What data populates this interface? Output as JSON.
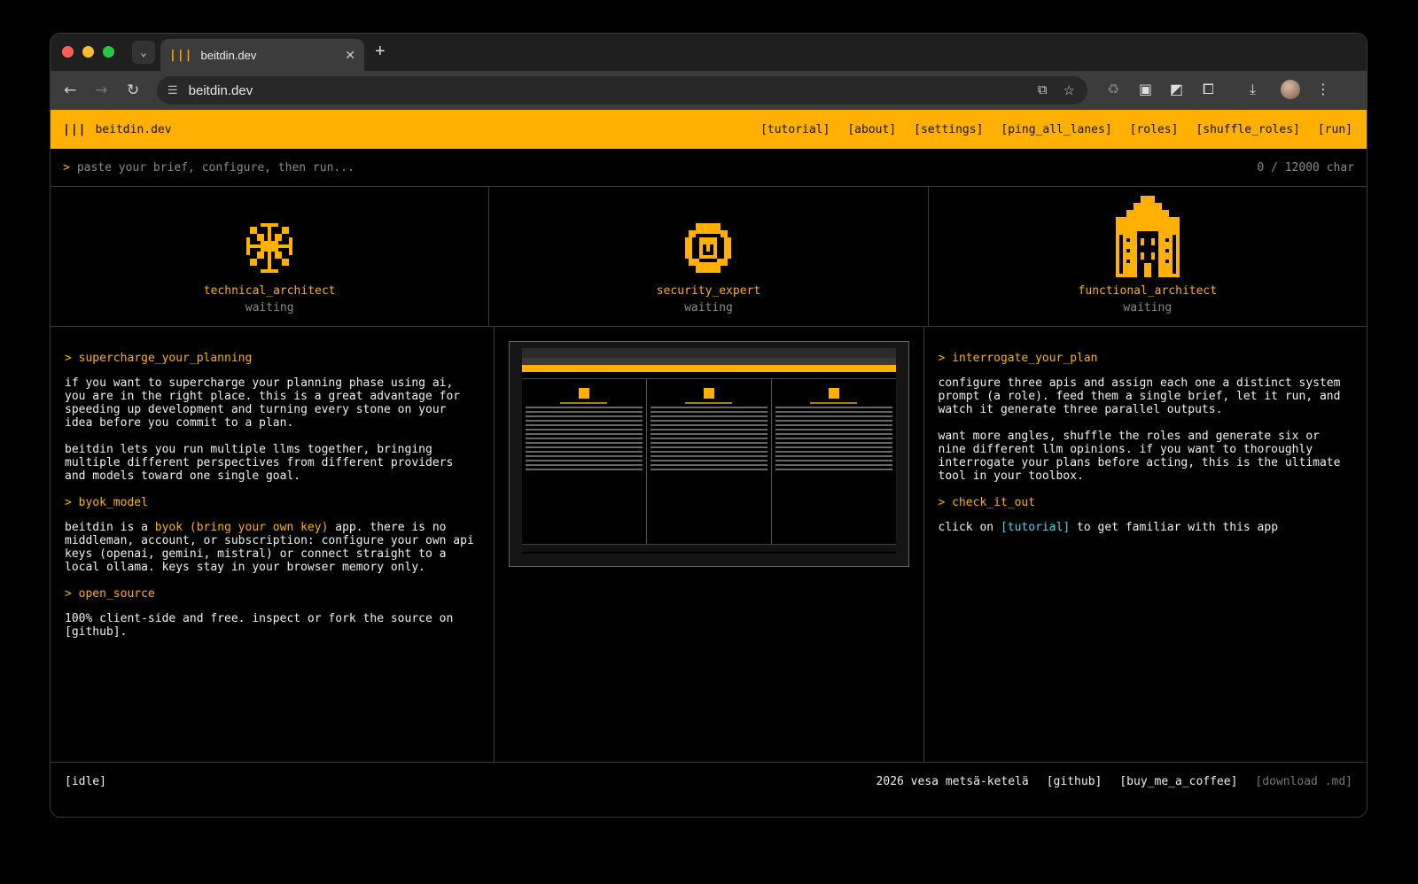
{
  "browser": {
    "tab_title": "beitdin.dev",
    "tab_favicon": "|||",
    "address": "beitdin.dev"
  },
  "app": {
    "logo": "|||",
    "title": "beitdin.dev",
    "nav": [
      "[tutorial]",
      "[about]",
      "[settings]",
      "[ping_all_lanes]",
      "[roles]",
      "[shuffle_roles]",
      "[run]"
    ],
    "brief_prompt": ">",
    "brief_placeholder": "paste your brief, configure, then run...",
    "char_count": "0 / 12000 char",
    "accent_color": "#ffb000",
    "link_color": "#4fd1ea"
  },
  "roles": [
    {
      "name": "technical_architect",
      "status": "waiting",
      "icon": "snowflake-icon"
    },
    {
      "name": "security_expert",
      "status": "waiting",
      "icon": "shield-face-icon"
    },
    {
      "name": "functional_architect",
      "status": "waiting",
      "icon": "building-icon"
    }
  ],
  "left_panel": {
    "h1": "> supercharge_your_planning",
    "p1": "if you want to supercharge your planning phase using ai, you are in the right place. this is a great advantage for speeding up development and turning every stone on your idea before you commit to a plan.",
    "p2": "beitdin lets you run multiple llms together, bringing multiple different perspectives from different providers and models toward one single goal.",
    "h2": "> byok_model",
    "p3_pre": "beitdin is a ",
    "p3_hl": "byok (bring your own key)",
    "p3_post": " app. there is no middleman, account, or subscription: configure your own api keys (openai, gemini, mistral) or connect straight to a local ollama. keys stay in your browser memory only.",
    "h3": "> open_source",
    "p4": "100% client-side and free. inspect or fork the source on [github]."
  },
  "right_panel": {
    "h1": "> interrogate_your_plan",
    "p1": "configure three apis and assign each one a distinct system prompt (a role). feed them a single brief, let it run, and watch it generate three parallel outputs.",
    "p2": "want more angles, shuffle the roles and generate six or nine different llm opinions. if you want to thoroughly interrogate your plans before acting, this is the ultimate tool in your toolbox.",
    "h2": "> check_it_out",
    "p3_pre": "click on ",
    "p3_link": "[tutorial]",
    "p3_post": " to get familiar with this app"
  },
  "footer": {
    "status": "[idle]",
    "credit": "2026 vesa metsä-ketelä",
    "github": "[github]",
    "coffee": "[buy_me_a_coffee]",
    "download": "[download .md]"
  }
}
